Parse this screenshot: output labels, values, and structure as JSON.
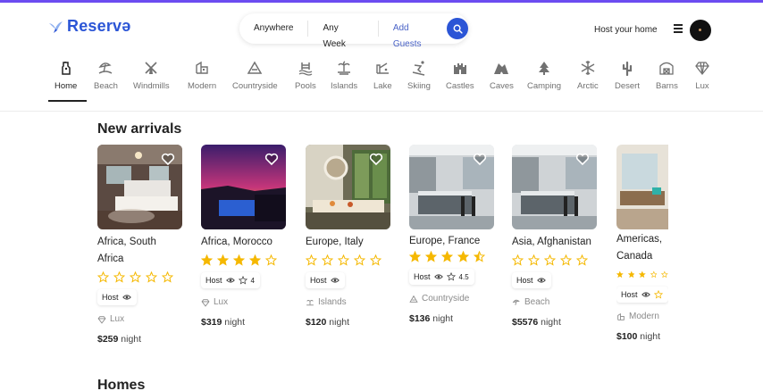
{
  "brand": {
    "name": "Reservə",
    "color": "#2b55d6"
  },
  "search": {
    "where": "Anywhere",
    "when": "Any Week",
    "guests": "Add Guests"
  },
  "header": {
    "host_link": "Host your home"
  },
  "categories": [
    {
      "label": "Home",
      "icon": "home-icon"
    },
    {
      "label": "Beach",
      "icon": "beach-icon"
    },
    {
      "label": "Windmills",
      "icon": "windmill-icon"
    },
    {
      "label": "Modern",
      "icon": "modern-icon"
    },
    {
      "label": "Countryside",
      "icon": "countryside-icon"
    },
    {
      "label": "Pools",
      "icon": "pool-icon"
    },
    {
      "label": "Islands",
      "icon": "island-icon"
    },
    {
      "label": "Lake",
      "icon": "lake-icon"
    },
    {
      "label": "Skiing",
      "icon": "skiing-icon"
    },
    {
      "label": "Castles",
      "icon": "castle-icon"
    },
    {
      "label": "Caves",
      "icon": "cave-icon"
    },
    {
      "label": "Camping",
      "icon": "camping-icon"
    },
    {
      "label": "Arctic",
      "icon": "snowflake-icon"
    },
    {
      "label": "Desert",
      "icon": "cactus-icon"
    },
    {
      "label": "Barns",
      "icon": "barn-icon"
    },
    {
      "label": "Lux",
      "icon": "diamond-icon"
    }
  ],
  "sections": {
    "new_arrivals": "New arrivals",
    "homes": "Homes"
  },
  "listings": [
    {
      "location": "Africa, South Africa",
      "rating": 0,
      "host_label": "Host",
      "rating_text": "",
      "category": "Lux",
      "price": "$259",
      "night": "night"
    },
    {
      "location": "Africa, Morocco",
      "rating": 4,
      "host_label": "Host",
      "rating_text": "4",
      "category": "Lux",
      "price": "$319",
      "night": "night"
    },
    {
      "location": "Europe, Italy",
      "rating": 0,
      "host_label": "Host",
      "rating_text": "",
      "category": "Islands",
      "price": "$120",
      "night": "night"
    },
    {
      "location": "Europe, France",
      "rating": 4.5,
      "host_label": "Host",
      "rating_text": "4.5",
      "category": "Countryside",
      "price": "$136",
      "night": "night"
    },
    {
      "location": "Asia, Afghanistan",
      "rating": 0,
      "host_label": "Host",
      "rating_text": "",
      "category": "Beach",
      "price": "$5576",
      "night": "night"
    },
    {
      "location": "Americas, Canada",
      "rating": 3,
      "host_label": "Host",
      "rating_text": "",
      "category": "Modern",
      "price": "$100",
      "night": "night"
    }
  ],
  "colors": {
    "star": "#f5b800",
    "accent": "#2b55d6",
    "topbar": "#6c4cf1"
  }
}
